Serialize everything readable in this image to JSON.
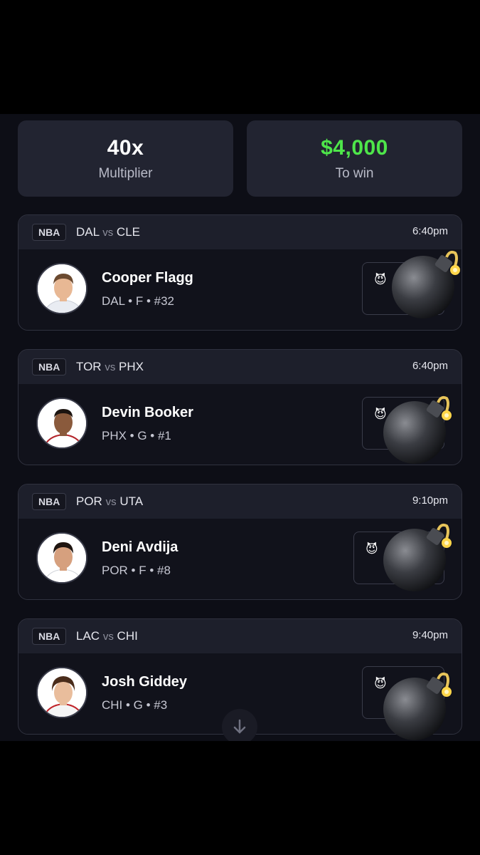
{
  "stats": {
    "multiplier_value": "40x",
    "multiplier_label": "Multiplier",
    "win_value": "$4,000",
    "win_label": "To win"
  },
  "picks": [
    {
      "league": "NBA",
      "team_a": "DAL",
      "vs": "vs",
      "team_b": "CLE",
      "time": "6:40pm",
      "player": "Cooper Flagg",
      "info": "DAL • F • #32",
      "jersey_color": "#e9ecf2",
      "skin": "#e8b894",
      "hair": "#6b4a30"
    },
    {
      "league": "NBA",
      "team_a": "TOR",
      "vs": "vs",
      "team_b": "PHX",
      "time": "6:40pm",
      "player": "Devin Booker",
      "info": "PHX • G • #1",
      "jersey_color": "#ffffff",
      "skin": "#8a5a3c",
      "hair": "#1c1410"
    },
    {
      "league": "NBA",
      "team_a": "POR",
      "vs": "vs",
      "team_b": "UTA",
      "time": "9:10pm",
      "player": "Deni Avdija",
      "info": "POR • F • #8",
      "jersey_color": "#ffffff",
      "skin": "#d6a07e",
      "hair": "#1e1510"
    },
    {
      "league": "NBA",
      "team_a": "LAC",
      "vs": "vs",
      "team_b": "CHI",
      "time": "9:40pm",
      "player": "Josh Giddey",
      "info": "CHI • G • #3",
      "jersey_color": "#f4f4f4",
      "skin": "#e9bd9c",
      "hair": "#4a2c1a"
    }
  ],
  "icons": {
    "devil": "devil-emoji",
    "bomb": "bomb-emoji",
    "scroll": "arrow-down-icon"
  },
  "colors": {
    "accent_green": "#4ee64a",
    "card_bg": "#11121b",
    "header_bg": "#1d1f2b"
  }
}
